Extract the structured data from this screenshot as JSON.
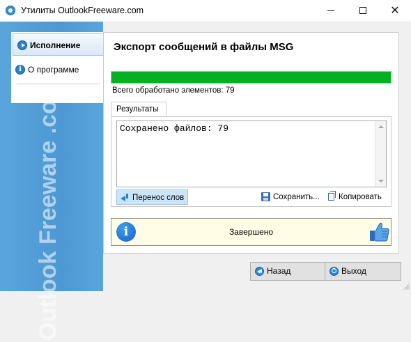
{
  "window": {
    "title": "Утилиты OutlookFreeware.com"
  },
  "sidebar": {
    "watermark": "Outlook Freeware .com",
    "items": [
      {
        "label": "Исполнение",
        "icon": "play-icon",
        "active": true
      },
      {
        "label": "О программе",
        "icon": "info-icon",
        "active": false
      }
    ]
  },
  "main": {
    "title": "Экспорт сообщений в файлы MSG",
    "progress": {
      "percent": 100,
      "color": "#06b025"
    },
    "status": "Всего обработано элементов: 79",
    "tab_label": "Результаты",
    "result_text": "Сохранено файлов: 79",
    "toolbar": {
      "wrap_label": "Перенос слов",
      "save_label": "Сохранить...",
      "copy_label": "Копировать"
    },
    "done_text": "Завершено"
  },
  "footer": {
    "back_label": "Назад",
    "exit_label": "Выход"
  },
  "colors": {
    "side_blue": "#4d98d3",
    "accent_blue": "#2d7fc9",
    "done_bg": "#fffde6"
  }
}
